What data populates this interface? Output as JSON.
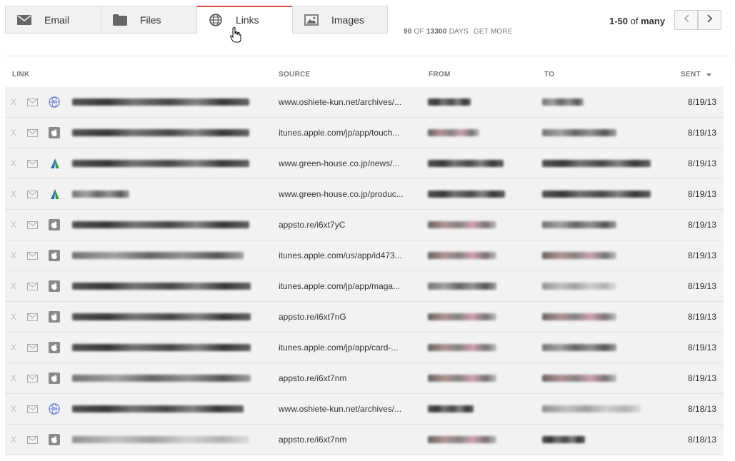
{
  "tabs": [
    {
      "label": "Email",
      "icon": "mail-icon",
      "active": false
    },
    {
      "label": "Files",
      "icon": "folder-icon",
      "active": false
    },
    {
      "label": "Links",
      "icon": "globe-icon",
      "active": true
    },
    {
      "label": "Images",
      "icon": "image-icon",
      "active": false
    }
  ],
  "days": {
    "count": "90",
    "of": "OF",
    "total": "13300",
    "unit": "DAYS",
    "more": "GET MORE"
  },
  "pager": {
    "range": "1-50",
    "of": "of",
    "total": "many"
  },
  "columns": {
    "link": "LINK",
    "source": "SOURCE",
    "from": "FROM",
    "to": "TO",
    "sent": "SENT"
  },
  "accent": "#dd4b39",
  "rows": [
    {
      "x": "X",
      "icon": "globe-icon",
      "source": "www.oshiete-kun.net/archives/...",
      "sent": "8/19/13"
    },
    {
      "x": "X",
      "icon": "apple-icon",
      "source": "itunes.apple.com/jp/app/touch...",
      "sent": "8/19/13"
    },
    {
      "x": "X",
      "icon": "greenhouse-icon",
      "source": "www.green-house.co.jp/news/...",
      "sent": "8/19/13"
    },
    {
      "x": "X",
      "icon": "greenhouse-icon",
      "source": "www.green-house.co.jp/produc...",
      "sent": "8/19/13"
    },
    {
      "x": "X",
      "icon": "apple-icon",
      "source": "appsto.re/i6xt7yC",
      "sent": "8/19/13"
    },
    {
      "x": "X",
      "icon": "apple-icon",
      "source": "itunes.apple.com/us/app/id473...",
      "sent": "8/19/13"
    },
    {
      "x": "X",
      "icon": "apple-icon",
      "source": "itunes.apple.com/jp/app/maga...",
      "sent": "8/19/13"
    },
    {
      "x": "X",
      "icon": "apple-icon",
      "source": "appsto.re/i6xt7nG",
      "sent": "8/19/13"
    },
    {
      "x": "X",
      "icon": "apple-icon",
      "source": "itunes.apple.com/jp/app/card-...",
      "sent": "8/19/13"
    },
    {
      "x": "X",
      "icon": "apple-icon",
      "source": "appsto.re/i6xt7nm",
      "sent": "8/19/13"
    },
    {
      "x": "X",
      "icon": "globe-icon",
      "source": "www.oshiete-kun.net/archives/...",
      "sent": "8/18/13"
    },
    {
      "x": "X",
      "icon": "apple-icon",
      "source": "appsto.re/i6xt7nm",
      "sent": "8/18/13"
    }
  ]
}
